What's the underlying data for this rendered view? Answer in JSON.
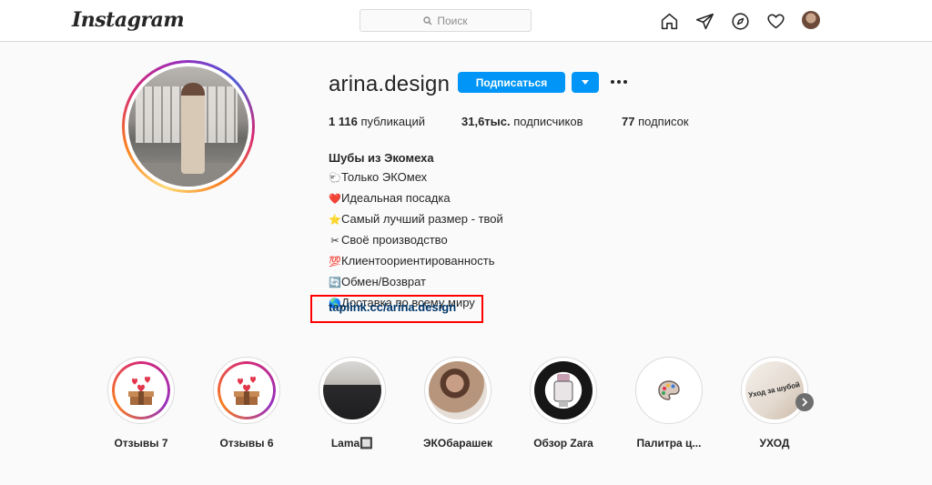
{
  "header": {
    "logo": "Instagram",
    "search_placeholder": "Поиск"
  },
  "profile": {
    "username": "arina.design",
    "follow_label": "Подписаться",
    "stats": [
      {
        "value": "1 116",
        "label": "публикаций"
      },
      {
        "value": "31,6тыс.",
        "label": "подписчиков"
      },
      {
        "value": "77",
        "label": "подписок"
      }
    ],
    "bio": {
      "name": "Шубы из Экомеха",
      "lines": [
        {
          "emoji": "🐑",
          "text": "Только ЭКОмех"
        },
        {
          "emoji": "❤️",
          "text": "Идеальная посадка"
        },
        {
          "emoji": "⭐",
          "text": "Самый лучший размер - твой"
        },
        {
          "emoji": "✂",
          "text": "Своё производство"
        },
        {
          "emoji": "💯",
          "text": "Клиентоориентированность"
        },
        {
          "emoji": "🔄",
          "text": "Обмен/Возврат"
        },
        {
          "emoji": "🌎",
          "text": "Доставка по всему миру"
        }
      ],
      "link": "taplink.cc/arina.design"
    }
  },
  "highlights": [
    {
      "label": "Отзывы 7"
    },
    {
      "label": "Отзывы 6"
    },
    {
      "label": "Lama🔲"
    },
    {
      "label": "ЭКОбарашек"
    },
    {
      "label": "Обзор Zara"
    },
    {
      "label": "Палитра ц..."
    },
    {
      "label": "УХОД",
      "overlay_text": "Уход за шубой"
    }
  ],
  "colors": {
    "accent": "#0095f6",
    "link": "#00376b",
    "annotation": "#ff0000"
  }
}
